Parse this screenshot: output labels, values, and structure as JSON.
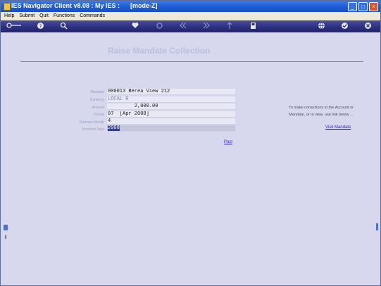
{
  "window": {
    "title": "IES Navigator Client v8.08 : My IES :      [mode-Z]"
  },
  "menu": {
    "items": [
      "Help",
      "Submit",
      "Quit",
      "Functions",
      "Commands"
    ]
  },
  "toolbar": {
    "icons": [
      "key-icon",
      "help-icon",
      "search-icon",
      "heart-icon",
      "refresh-icon",
      "back-icon",
      "forward-icon",
      "up-icon",
      "save-icon",
      "world-icon",
      "ok-icon",
      "cancel-icon"
    ]
  },
  "form": {
    "title": "Raise Mandate Collection",
    "fields": [
      {
        "label": "Mandate",
        "value": "000013 Berea View 212"
      },
      {
        "label": "Currency",
        "value": "LOCAL R"
      },
      {
        "label": "Amount",
        "value": "         2,000.00"
      },
      {
        "label": "Period",
        "value": "07  [Apr 2008]"
      },
      {
        "label": "Premium Month",
        "value": "4"
      },
      {
        "label": "Premium Year",
        "value": "2008"
      }
    ],
    "post_label": "Post"
  },
  "info": {
    "line1": "To make corrections to the Account or",
    "line2": "Mandate, or to view, use link below ...",
    "link": "Visit Mandate"
  },
  "colors": {
    "titlebar": "#1f5fd6",
    "toolbar": "#2b2e7c",
    "content_bg": "#d7d8ee",
    "link": "#2a22c8"
  }
}
